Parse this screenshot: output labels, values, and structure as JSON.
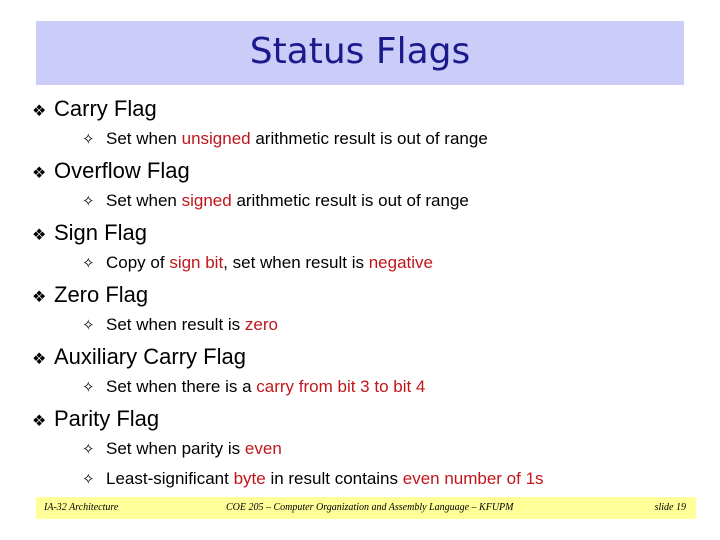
{
  "slide": {
    "title": "Status Flags",
    "bullet_l1_glyph": "❖",
    "bullet_l2_glyph": "✧",
    "items": [
      {
        "heading": "Carry Flag",
        "subs": [
          [
            [
              "Set when ",
              false
            ],
            [
              "unsigned",
              true
            ],
            [
              " arithmetic result is out of range",
              false
            ]
          ]
        ]
      },
      {
        "heading": "Overflow Flag",
        "subs": [
          [
            [
              "Set when ",
              false
            ],
            [
              "signed",
              true
            ],
            [
              " arithmetic result is out of range",
              false
            ]
          ]
        ]
      },
      {
        "heading": "Sign Flag",
        "subs": [
          [
            [
              "Copy of ",
              false
            ],
            [
              "sign bit",
              true
            ],
            [
              ", set when result is ",
              false
            ],
            [
              "negative",
              true
            ]
          ]
        ]
      },
      {
        "heading": "Zero Flag",
        "subs": [
          [
            [
              "Set when result is ",
              false
            ],
            [
              "zero",
              true
            ]
          ]
        ]
      },
      {
        "heading": "Auxiliary Carry Flag",
        "subs": [
          [
            [
              "Set when there is a ",
              false
            ],
            [
              "carry from bit 3 to bit 4",
              true
            ]
          ]
        ]
      },
      {
        "heading": "Parity Flag",
        "subs": [
          [
            [
              "Set when parity is ",
              false
            ],
            [
              "even",
              true
            ]
          ],
          [
            [
              "Least-significant ",
              false
            ],
            [
              "byte",
              true
            ],
            [
              " in result contains ",
              false
            ],
            [
              "even number of 1s",
              true
            ]
          ]
        ]
      }
    ]
  },
  "footer": {
    "left": "IA-32 Architecture",
    "center": "COE 205 – Computer Organization and Assembly Language – KFUPM",
    "right": "slide 19"
  },
  "colors": {
    "highlight": "#c0161b",
    "title": "#1a1a8c",
    "title_bg": "#ccccf8",
    "footer_bg": "#ffff99"
  }
}
